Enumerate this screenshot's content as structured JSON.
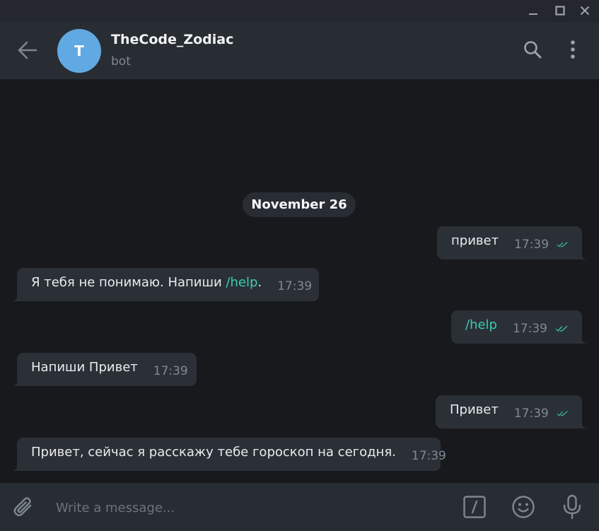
{
  "window": {
    "minimize_icon": "minimize-icon",
    "maximize_icon": "maximize-icon",
    "close_icon": "close-icon"
  },
  "header": {
    "avatar_letter": "T",
    "name": "TheCode_Zodiac",
    "status": "bot",
    "avatar_color": "#61a9e3"
  },
  "chat": {
    "date": "November 26",
    "messages": [
      {
        "dir": "out",
        "text": "привет",
        "time": "17:39",
        "read": true
      },
      {
        "dir": "in",
        "text_before": "Я тебя не понимаю. Напиши ",
        "link": "/help",
        "text_after": ".",
        "time": "17:39"
      },
      {
        "dir": "out",
        "link": "/help",
        "time": "17:39",
        "read": true
      },
      {
        "dir": "in",
        "text": "Напиши Привет",
        "time": "17:39"
      },
      {
        "dir": "out",
        "text": "Привет",
        "time": "17:39",
        "read": true
      },
      {
        "dir": "in",
        "text": "Привет, сейчас я расскажу тебе гороскоп на сегодня.",
        "time": "17:39"
      }
    ]
  },
  "composer": {
    "placeholder": "Write a message..."
  },
  "colors": {
    "background": "#17191d",
    "panel": "#282d33",
    "bubble": "#2b3037",
    "accent": "#3ccbb1"
  }
}
